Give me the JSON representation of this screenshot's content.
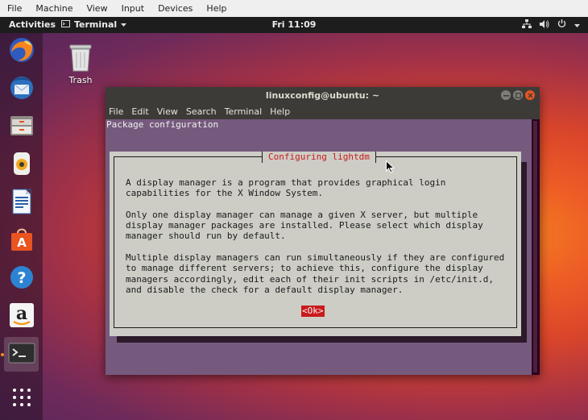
{
  "vbox_menu": [
    "File",
    "Machine",
    "View",
    "Input",
    "Devices",
    "Help"
  ],
  "panel": {
    "activities": "Activities",
    "app_menu": "Terminal",
    "clock": "Fri 11:09"
  },
  "desktop": {
    "trash_label": "Trash"
  },
  "dock_icons": [
    "firefox-icon",
    "thunderbird-icon",
    "files-icon",
    "rhythmbox-icon",
    "libreoffice-writer-icon",
    "software-center-icon",
    "help-icon",
    "amazon-icon",
    "terminal-icon",
    "show-applications-icon"
  ],
  "terminal": {
    "title": "linuxconfig@ubuntu: ~",
    "menu": [
      "File",
      "Edit",
      "View",
      "Search",
      "Terminal",
      "Help"
    ],
    "header_line": "Package configuration",
    "dialog": {
      "title": "Configuring lightdm",
      "paragraphs": [
        "A display manager is a program that provides graphical login\ncapabilities for the X Window System.",
        "Only one display manager can manage a given X server, but multiple\ndisplay manager packages are installed. Please select which display\nmanager should run by default.",
        "Multiple display managers can run simultaneously if they are configured\nto manage different servers; to achieve this, configure the display\nmanagers accordingly, edit each of their init scripts in /etc/init.d,\nand disable the check for a default display manager."
      ],
      "ok_label": "<Ok>"
    }
  },
  "colors": {
    "accent": "#e95420",
    "dialog_red": "#c91b1b",
    "terminal_bg": "#765a7e"
  }
}
